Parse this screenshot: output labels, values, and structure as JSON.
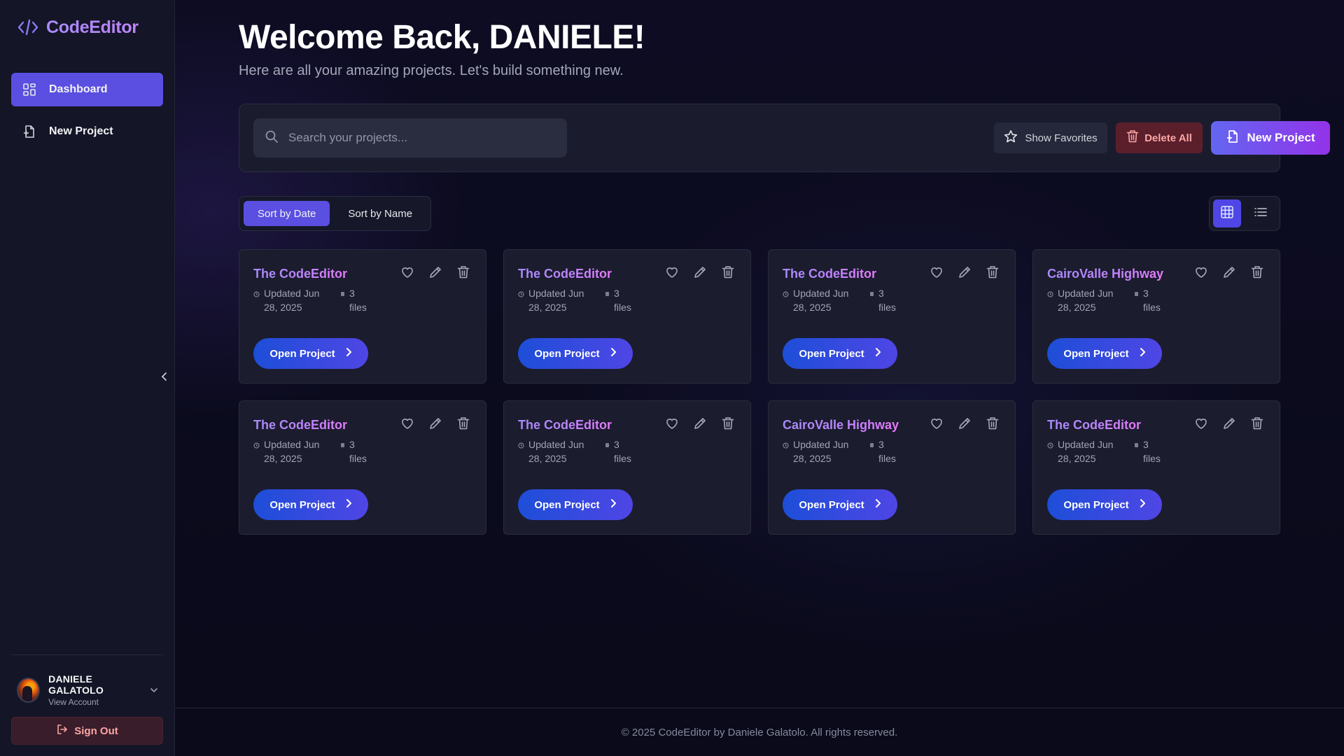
{
  "app": {
    "name": "CodeEditor",
    "logo_icon": "code-brackets-icon",
    "accent": "#5a4fe0",
    "brand_gradient": [
      "#6366f1",
      "#9333ea"
    ]
  },
  "sidebar": {
    "items": [
      {
        "label": "Dashboard",
        "icon": "dashboard-grid-icon",
        "active": true
      },
      {
        "label": "New Project",
        "icon": "file-plus-icon",
        "active": false
      }
    ],
    "collapse_icon": "chevron-left-icon",
    "account": {
      "name": "DANIELE GALATOLO",
      "subtitle": "View Account"
    },
    "signout_label": "Sign Out"
  },
  "header": {
    "title": "Welcome Back, DANIELE!",
    "subtitle": "Here are all your amazing projects. Let's build something new."
  },
  "toolbar": {
    "search_placeholder": "Search your projects...",
    "show_favorites": "Show Favorites",
    "delete_all": "Delete All",
    "new_project": "New Project"
  },
  "sort": {
    "options": [
      "Sort by Date",
      "Sort by Name"
    ],
    "active": "Sort by Date"
  },
  "view": {
    "active": "grid"
  },
  "projects": [
    {
      "title": "The CodeEditor",
      "updated": "Updated Jun 28, 2025",
      "files": "3 files",
      "open_label": "Open Project"
    },
    {
      "title": "The CodeEditor",
      "updated": "Updated Jun 28, 2025",
      "files": "3 files",
      "open_label": "Open Project"
    },
    {
      "title": "The CodeEditor",
      "updated": "Updated Jun 28, 2025",
      "files": "3 files",
      "open_label": "Open Project"
    },
    {
      "title": "CairoValle Highway",
      "updated": "Updated Jun 28, 2025",
      "files": "3 files",
      "open_label": "Open Project"
    },
    {
      "title": "The CodeEditor",
      "updated": "Updated Jun 28, 2025",
      "files": "3 files",
      "open_label": "Open Project"
    },
    {
      "title": "The CodeEditor",
      "updated": "Updated Jun 28, 2025",
      "files": "3 files",
      "open_label": "Open Project"
    },
    {
      "title": "CairoValle Highway",
      "updated": "Updated Jun 28, 2025",
      "files": "3 files",
      "open_label": "Open Project"
    },
    {
      "title": "The CodeEditor",
      "updated": "Updated Jun 28, 2025",
      "files": "3 files",
      "open_label": "Open Project"
    }
  ],
  "footer": {
    "text": "© 2025 CodeEditor by Daniele Galatolo. All rights reserved."
  }
}
